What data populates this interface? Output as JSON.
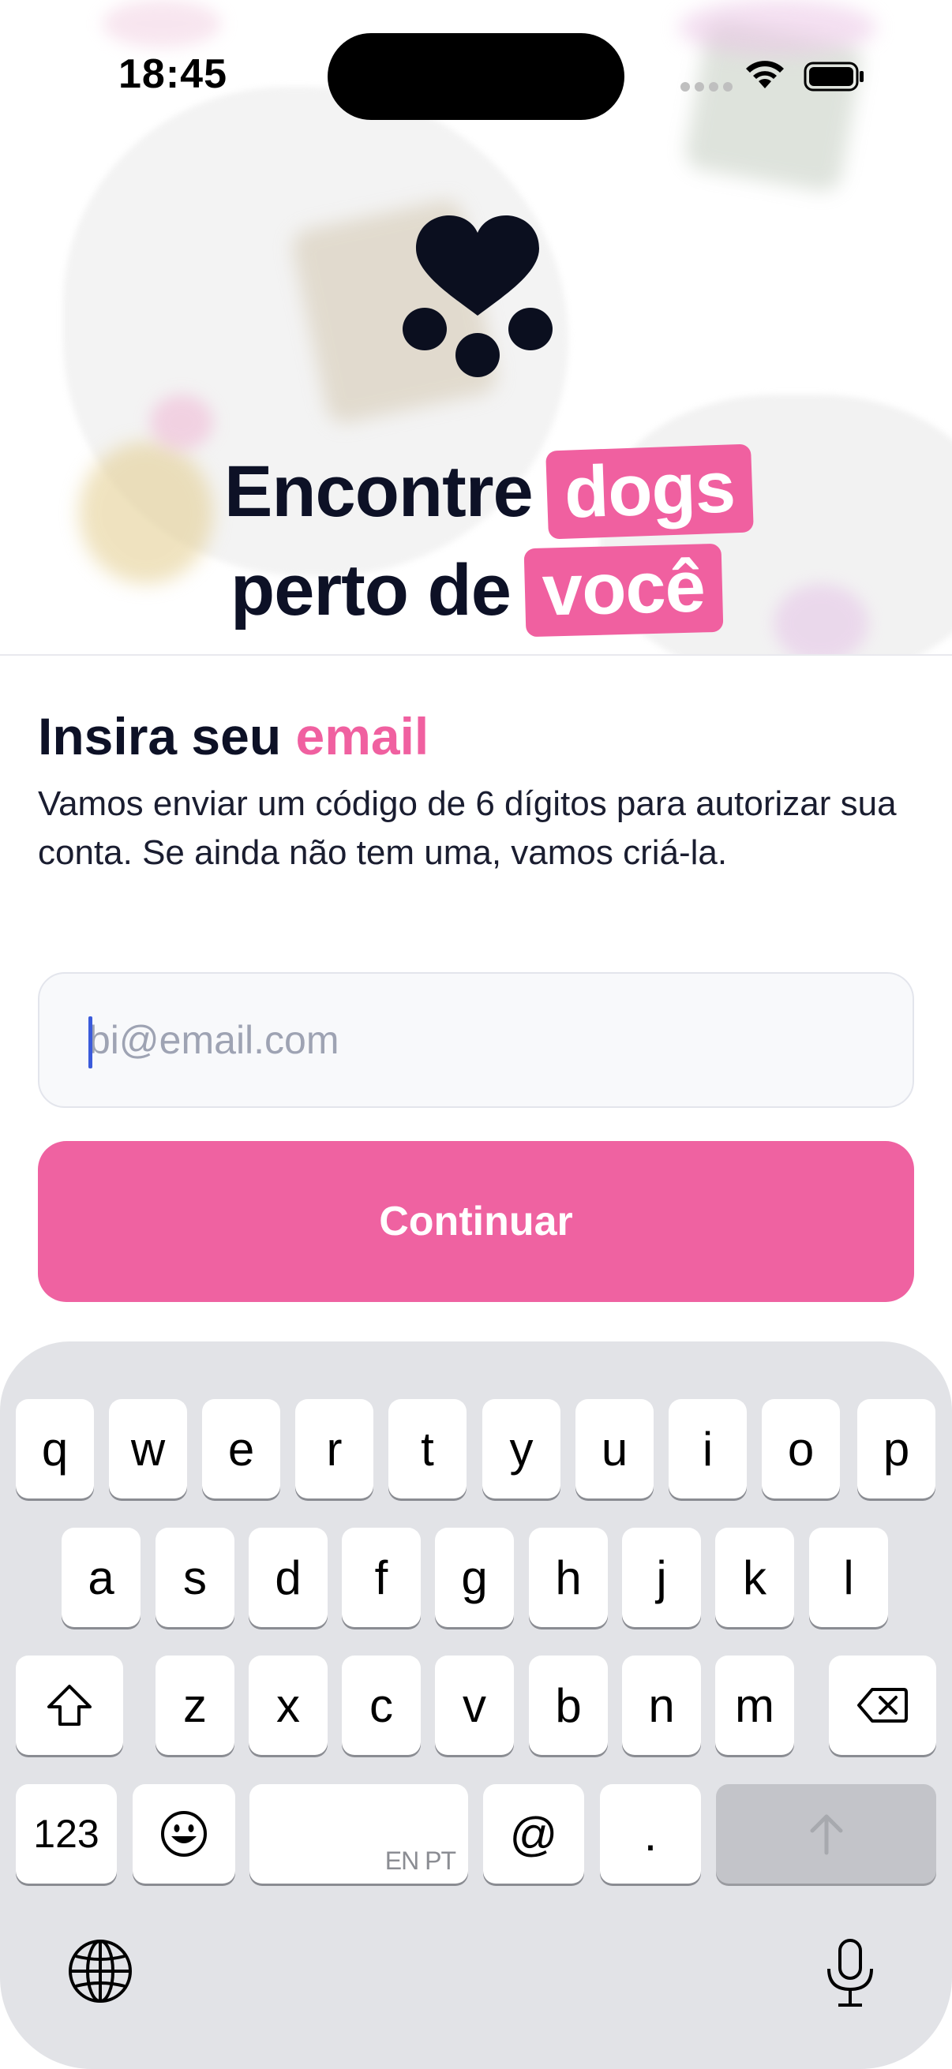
{
  "status_bar": {
    "time": "18:45"
  },
  "hero": {
    "line1_text": "Encontre",
    "line1_highlight": "dogs",
    "line2_text": "perto de",
    "line2_highlight": "você"
  },
  "form": {
    "title_text": "Insira seu",
    "title_accent": "email",
    "description": "Vamos enviar um código de 6 dígitos para autorizar sua conta. Se ainda não tem uma, vamos criá-la.",
    "email_placeholder": "bi@email.com",
    "email_value": "",
    "continue_label": "Continuar"
  },
  "colors": {
    "accent": "#f060a0",
    "button": "#ef62a1",
    "text": "#0d1126",
    "keyboard_bg": "#e2e3e7"
  },
  "keyboard": {
    "row1": [
      "q",
      "w",
      "e",
      "r",
      "t",
      "y",
      "u",
      "i",
      "o",
      "p"
    ],
    "row2": [
      "a",
      "s",
      "d",
      "f",
      "g",
      "h",
      "j",
      "k",
      "l"
    ],
    "row3": [
      "z",
      "x",
      "c",
      "v",
      "b",
      "n",
      "m"
    ],
    "numbers_label": "123",
    "space_language": "EN PT",
    "at_label": "@",
    "dot_label": "."
  }
}
